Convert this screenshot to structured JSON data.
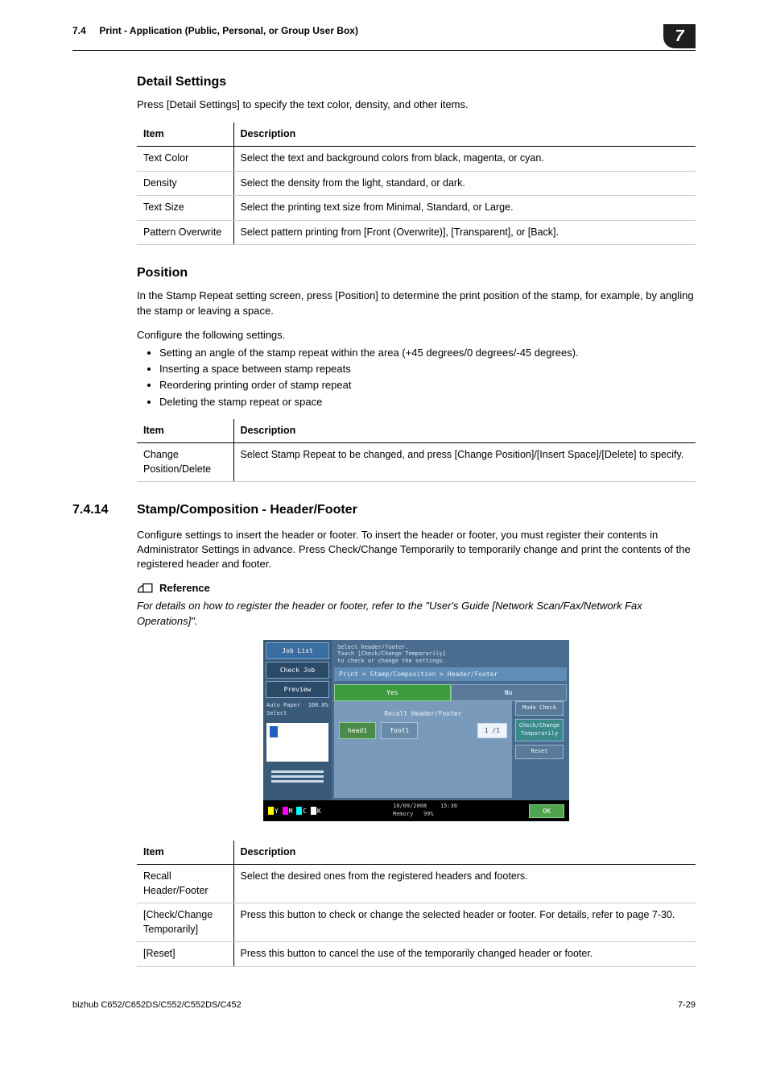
{
  "header": {
    "section_num": "7.4",
    "section_title": "Print - Application (Public, Personal, or Group User Box)",
    "chapter": "7"
  },
  "detail_settings": {
    "heading": "Detail Settings",
    "intro": "Press [Detail Settings] to specify the text color, density, and other items.",
    "cols": {
      "item": "Item",
      "desc": "Description"
    },
    "rows": [
      {
        "item": "Text Color",
        "desc": "Select the text and background colors from black, magenta, or cyan."
      },
      {
        "item": "Density",
        "desc": "Select the density from the light, standard, or dark."
      },
      {
        "item": "Text Size",
        "desc": "Select the printing text size from Minimal, Standard, or Large."
      },
      {
        "item": "Pattern Overwrite",
        "desc": "Select pattern printing from [Front (Overwrite)], [Transparent], or [Back]."
      }
    ]
  },
  "position": {
    "heading": "Position",
    "intro": "In the Stamp Repeat setting screen, press [Position] to determine the print position of the stamp, for example, by angling the stamp or leaving a space.",
    "config": "Configure the following settings.",
    "bullets": [
      "Setting an angle of the stamp repeat within the area (+45 degrees/0 degrees/-45 degrees).",
      "Inserting a space between stamp repeats",
      "Reordering printing order of stamp repeat",
      "Deleting the stamp repeat or space"
    ],
    "cols": {
      "item": "Item",
      "desc": "Description"
    },
    "rows": [
      {
        "item": "Change Position/Delete",
        "desc": "Select Stamp Repeat to be changed, and press [Change Position]/[Insert Space]/[Delete] to specify."
      }
    ]
  },
  "stamp_comp": {
    "num": "7.4.14",
    "title": "Stamp/Composition - Header/Footer",
    "intro": "Configure settings to insert the header or footer. To insert the header or footer, you must register their contents in Administrator Settings in advance. Press Check/Change Temporarily to temporarily change and print the contents of the registered header and footer.",
    "ref_label": "Reference",
    "ref_text": "For details on how to register the header or footer, refer to the \"User's Guide [Network Scan/Fax/Network Fax Operations]\".",
    "cols": {
      "item": "Item",
      "desc": "Description"
    },
    "rows": [
      {
        "item": "Recall Header/Footer",
        "desc": "Select the desired ones from the registered headers and footers."
      },
      {
        "item": "[Check/Change Temporarily]",
        "desc": "Press this button to check or change the selected header or footer. For details, refer to page 7-30."
      },
      {
        "item": "[Reset]",
        "desc": "Press this button to cancel the use of the temporarily changed header or footer."
      }
    ]
  },
  "ui": {
    "job_list": "Job List",
    "check_job": "Check Job",
    "preview": "Preview",
    "auto_paper": "Auto Paper Select",
    "zoom": "100.0%",
    "instr": "Select header/footer.\nTouch [Check/Change Temporarily]\nto check or change the settings.",
    "breadcrumb": "Print > Stamp/Composition > Header/Footer",
    "yes": "Yes",
    "no": "No",
    "recall": "Recall Header/Footer",
    "head1": "head1",
    "foot1": "foot1",
    "page": "1  /1",
    "mode_check": "Mode Check",
    "check_change": "Check/Change Temporarily",
    "reset": "Reset",
    "date": "10/09/2008",
    "time": "15:36",
    "memory": "Memory",
    "mem_pct": "99%",
    "ok": "OK"
  },
  "footer": {
    "model": "bizhub C652/C652DS/C552/C552DS/C452",
    "page": "7-29"
  }
}
